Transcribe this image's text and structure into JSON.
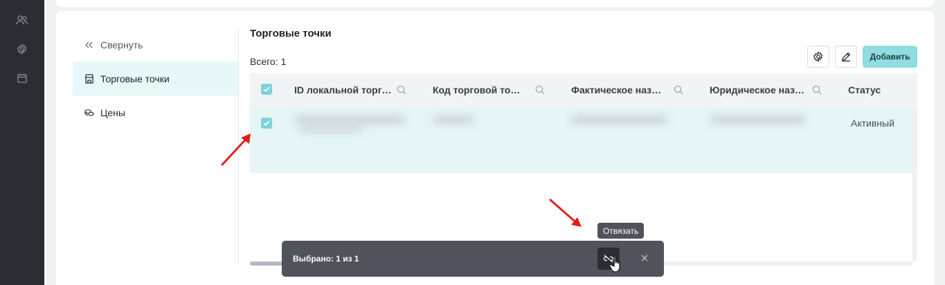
{
  "rail": {
    "icons": [
      "users-icon",
      "gear-icon",
      "calendar-icon"
    ]
  },
  "sidebar": {
    "collapse_label": "Свернуть",
    "items": [
      {
        "label": "Торговые точки",
        "icon": "store-icon",
        "active": true
      },
      {
        "label": "Цены",
        "icon": "coins-icon",
        "active": false
      }
    ]
  },
  "main": {
    "title": "Торговые точки",
    "total_label": "Всего:",
    "total_value": "1",
    "toolbar": {
      "settings_icon": "gear-icon",
      "edit_icon": "pencil-icon",
      "add_label": "Добавить"
    },
    "table": {
      "columns": [
        {
          "label": "ID локальной торг…",
          "searchable": true
        },
        {
          "label": "Код торговой то…",
          "searchable": true
        },
        {
          "label": "Фактическое наз…",
          "searchable": true
        },
        {
          "label": "Юридическое наз…",
          "searchable": true
        },
        {
          "label": "Статус",
          "searchable": false
        }
      ],
      "rows": [
        {
          "selected": true,
          "status": "Активный"
        }
      ]
    },
    "selection_bar": {
      "text": "Выбрано: 1 из 1",
      "unlink_tooltip": "Отвязать"
    }
  },
  "colors": {
    "accent": "#8fdde2",
    "rail": "#2c2d33",
    "active_row": "#e6f6f7",
    "annotation": "#e02020"
  }
}
